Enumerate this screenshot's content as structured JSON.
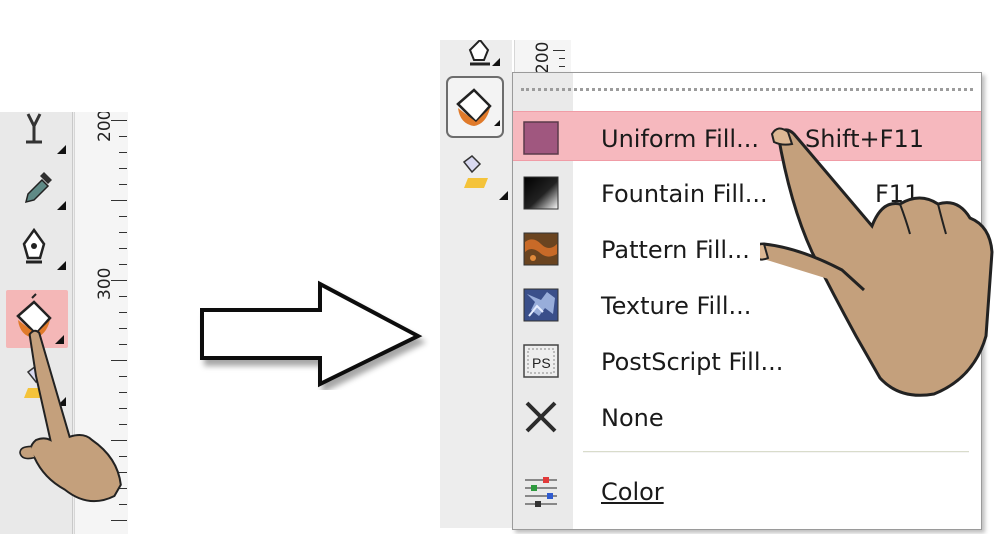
{
  "left_ruler": {
    "labels": [
      "200",
      "300"
    ]
  },
  "right_ruler": {
    "labels": [
      "200"
    ]
  },
  "fill_menu": {
    "items": [
      {
        "label": "Uniform Fill...",
        "shortcut": "Shift+F11",
        "icon": "uniform-fill-icon",
        "color": "#a0577f"
      },
      {
        "label": "Fountain Fill...",
        "shortcut": "F11",
        "icon": "fountain-fill-icon"
      },
      {
        "label": "Pattern Fill...",
        "shortcut": "",
        "icon": "pattern-fill-icon"
      },
      {
        "label": "Texture Fill...",
        "shortcut": "",
        "icon": "texture-fill-icon"
      },
      {
        "label": "PostScript Fill...",
        "shortcut": "",
        "icon": "postscript-fill-icon",
        "icon_text": "PS"
      },
      {
        "label": "None",
        "shortcut": "",
        "icon": "none-icon"
      },
      {
        "label": "Color",
        "shortcut": "",
        "icon": "color-docker-icon"
      }
    ]
  },
  "colors": {
    "highlight": "#f6b8be",
    "active_tool": "#f4b7b7",
    "hand_skin": "#c4a07c"
  }
}
